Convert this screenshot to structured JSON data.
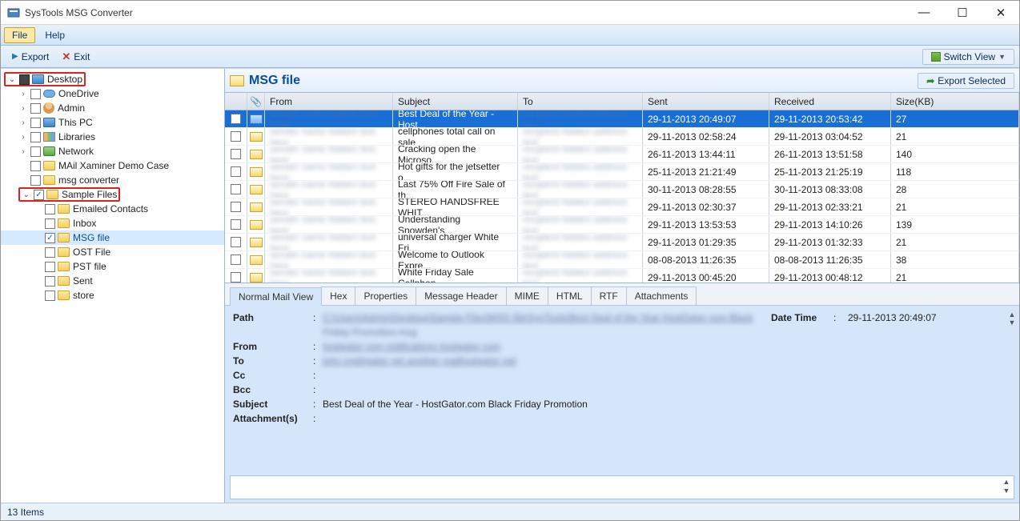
{
  "window": {
    "title": "SysTools MSG Converter"
  },
  "menubar": {
    "file": "File",
    "help": "Help"
  },
  "toolbar": {
    "export": "Export",
    "exit": "Exit",
    "switch_view": "Switch View"
  },
  "tree": [
    {
      "lvl": 0,
      "exp": "v",
      "chk": "mixed",
      "icon": "monitor",
      "label": "Desktop",
      "boxed": true
    },
    {
      "lvl": 1,
      "exp": ">",
      "chk": "",
      "icon": "cloud",
      "label": "OneDrive"
    },
    {
      "lvl": 1,
      "exp": ">",
      "chk": "",
      "icon": "user",
      "label": "Admin"
    },
    {
      "lvl": 1,
      "exp": ">",
      "chk": "",
      "icon": "monitor",
      "label": "This PC"
    },
    {
      "lvl": 1,
      "exp": ">",
      "chk": "",
      "icon": "lib",
      "label": "Libraries"
    },
    {
      "lvl": 1,
      "exp": ">",
      "chk": "",
      "icon": "net",
      "label": "Network"
    },
    {
      "lvl": 1,
      "exp": "",
      "chk": "",
      "icon": "folder",
      "label": "MAil Xaminer Demo Case"
    },
    {
      "lvl": 1,
      "exp": "",
      "chk": "",
      "icon": "folder",
      "label": "msg converter"
    },
    {
      "lvl": 1,
      "exp": "v",
      "chk": "checked",
      "icon": "folder",
      "label": "Sample Files",
      "boxed": true
    },
    {
      "lvl": 2,
      "exp": "",
      "chk": "",
      "icon": "folder",
      "label": "Emailed Contacts"
    },
    {
      "lvl": 2,
      "exp": "",
      "chk": "",
      "icon": "folder",
      "label": "Inbox"
    },
    {
      "lvl": 2,
      "exp": "",
      "chk": "checked",
      "icon": "folder",
      "label": "MSG file",
      "selected": true
    },
    {
      "lvl": 2,
      "exp": "",
      "chk": "",
      "icon": "folder",
      "label": "OST File"
    },
    {
      "lvl": 2,
      "exp": "",
      "chk": "",
      "icon": "folder",
      "label": "PST file"
    },
    {
      "lvl": 2,
      "exp": "",
      "chk": "",
      "icon": "folder",
      "label": "Sent"
    },
    {
      "lvl": 2,
      "exp": "",
      "chk": "",
      "icon": "folder",
      "label": "store"
    }
  ],
  "list_header": {
    "title": "MSG file",
    "export_selected": "Export Selected"
  },
  "columns": {
    "from": "From",
    "subject": "Subject",
    "to": "To",
    "sent": "Sent",
    "received": "Received",
    "size": "Size(KB)"
  },
  "rows": [
    {
      "subject": "Best Deal of the Year - Host...",
      "sent": "29-11-2013 20:49:07",
      "recv": "29-11-2013 20:53:42",
      "size": "27",
      "selected": true
    },
    {
      "subject": "cellphones total call on sale",
      "sent": "29-11-2013 02:58:24",
      "recv": "29-11-2013 03:04:52",
      "size": "21"
    },
    {
      "subject": "Cracking open the Microso...",
      "sent": "26-11-2013 13:44:11",
      "recv": "26-11-2013 13:51:58",
      "size": "140"
    },
    {
      "subject": "Hot gifts for the jetsetter o...",
      "sent": "25-11-2013 21:21:49",
      "recv": "25-11-2013 21:25:19",
      "size": "118"
    },
    {
      "subject": "Last 75% Off Fire Sale of th...",
      "sent": "30-11-2013 08:28:55",
      "recv": "30-11-2013 08:33:08",
      "size": "28"
    },
    {
      "subject": "STEREO HANDSFREE WHIT...",
      "sent": "29-11-2013 02:30:37",
      "recv": "29-11-2013 02:33:21",
      "size": "21"
    },
    {
      "subject": "Understanding Snowden's...",
      "sent": "29-11-2013 13:53:53",
      "recv": "29-11-2013 14:10:26",
      "size": "139"
    },
    {
      "subject": "universal charger White Fri...",
      "sent": "29-11-2013 01:29:35",
      "recv": "29-11-2013 01:32:33",
      "size": "21"
    },
    {
      "subject": "Welcome to Outlook Expre...",
      "sent": "08-08-2013 11:26:35",
      "recv": "08-08-2013 11:26:35",
      "size": "38"
    },
    {
      "subject": "White Friday Sale Cellphon...",
      "sent": "29-11-2013 00:45:20",
      "recv": "29-11-2013 00:48:12",
      "size": "21"
    }
  ],
  "tabs": [
    "Normal Mail View",
    "Hex",
    "Properties",
    "Message Header",
    "MIME",
    "HTML",
    "RTF",
    "Attachments"
  ],
  "detail": {
    "labels": {
      "path": "Path",
      "from": "From",
      "to": "To",
      "cc": "Cc",
      "bcc": "Bcc",
      "subject": "Subject",
      "attachments": "Attachment(s)",
      "datetime": "Date Time"
    },
    "path_tail": "Friday Promotion.msg",
    "subject": "Best Deal of the Year - HostGator.com Black Friday Promotion",
    "datetime": "29-11-2013 20:49:07"
  },
  "status": {
    "items": "13 Items"
  }
}
